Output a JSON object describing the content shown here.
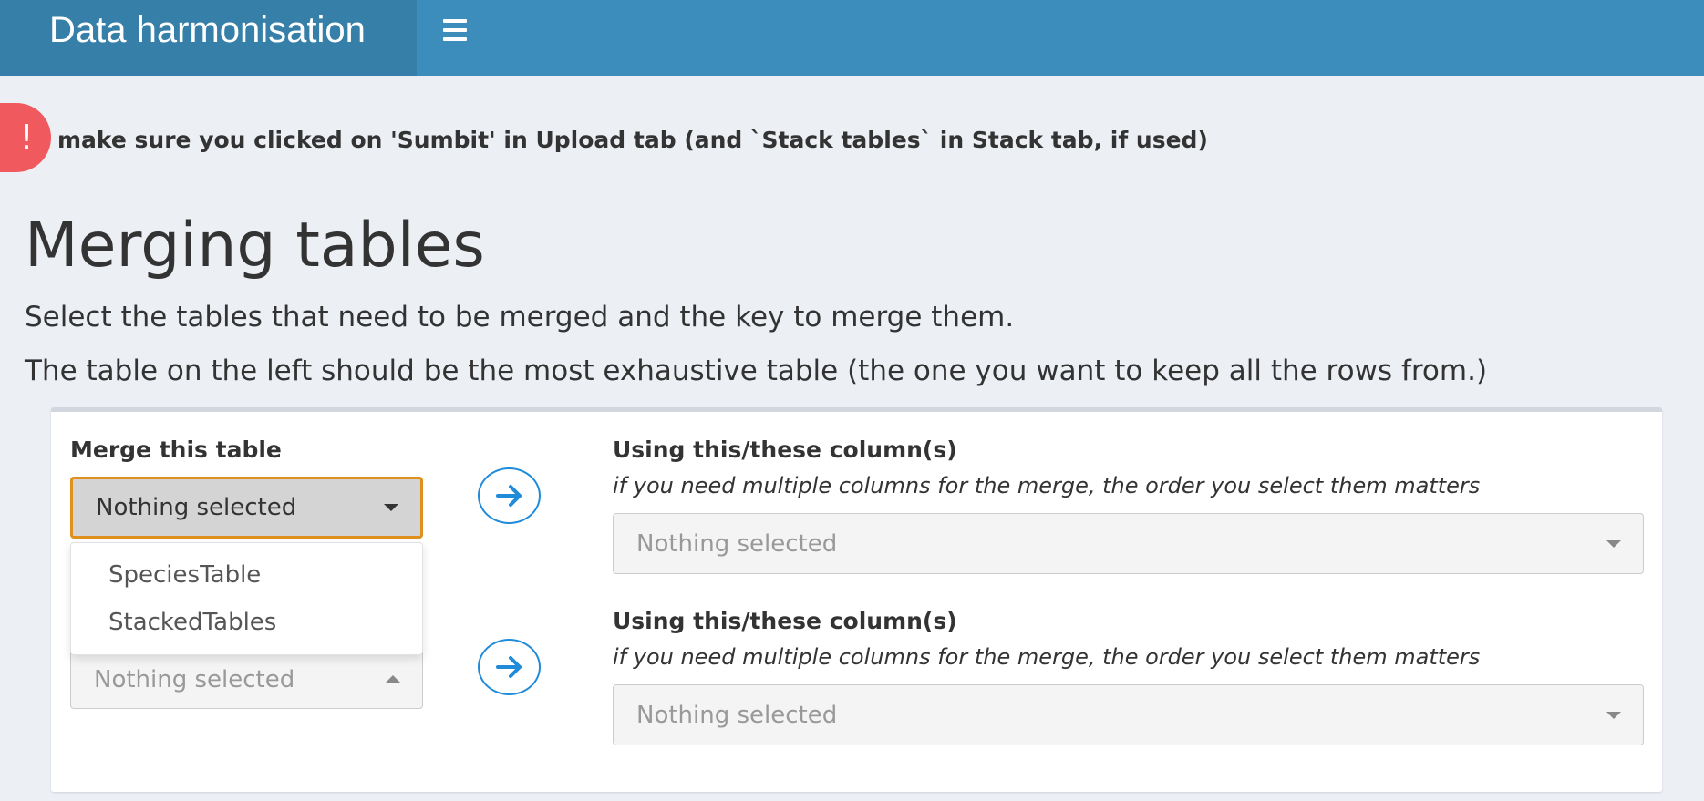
{
  "header": {
    "brand": "Data harmonisation",
    "menu_icon": "hamburger-menu-icon",
    "bg_color": "#3c8dbc",
    "brand_bg_color": "#367fa9"
  },
  "alert": {
    "icon": "exclamation-icon",
    "icon_glyph": "!",
    "icon_color": "#f05a5f",
    "text": "make sure you clicked on 'Sumbit' in Upload tab (and `Stack tables` in Stack tab, if used)"
  },
  "page": {
    "title": "Merging tables",
    "description1": "Select the tables that need to be merged and the key to merge them.",
    "description2": "The table on the left should be the most exhaustive table (the one you want to keep all the rows from.)"
  },
  "merge_box": {
    "left_label": "Merge this table",
    "left_select_value": "Nothing selected",
    "dropdown_options": [
      "SpeciesTable",
      "StackedTables"
    ],
    "left_select2_value": "Nothing selected",
    "rows": [
      {
        "column_label": "Using this/these column(s)",
        "hint": "if you need multiple columns for the merge, the order you select them matters",
        "select_value": "Nothing selected"
      },
      {
        "column_label": "Using this/these column(s)",
        "hint": "if you need multiple columns for the merge, the order you select them matters",
        "select_value": "Nothing selected"
      }
    ],
    "arrow_icon": "arrow-right-icon",
    "accent_color": "#1f8bd9",
    "focus_border_color": "#e0901c"
  }
}
